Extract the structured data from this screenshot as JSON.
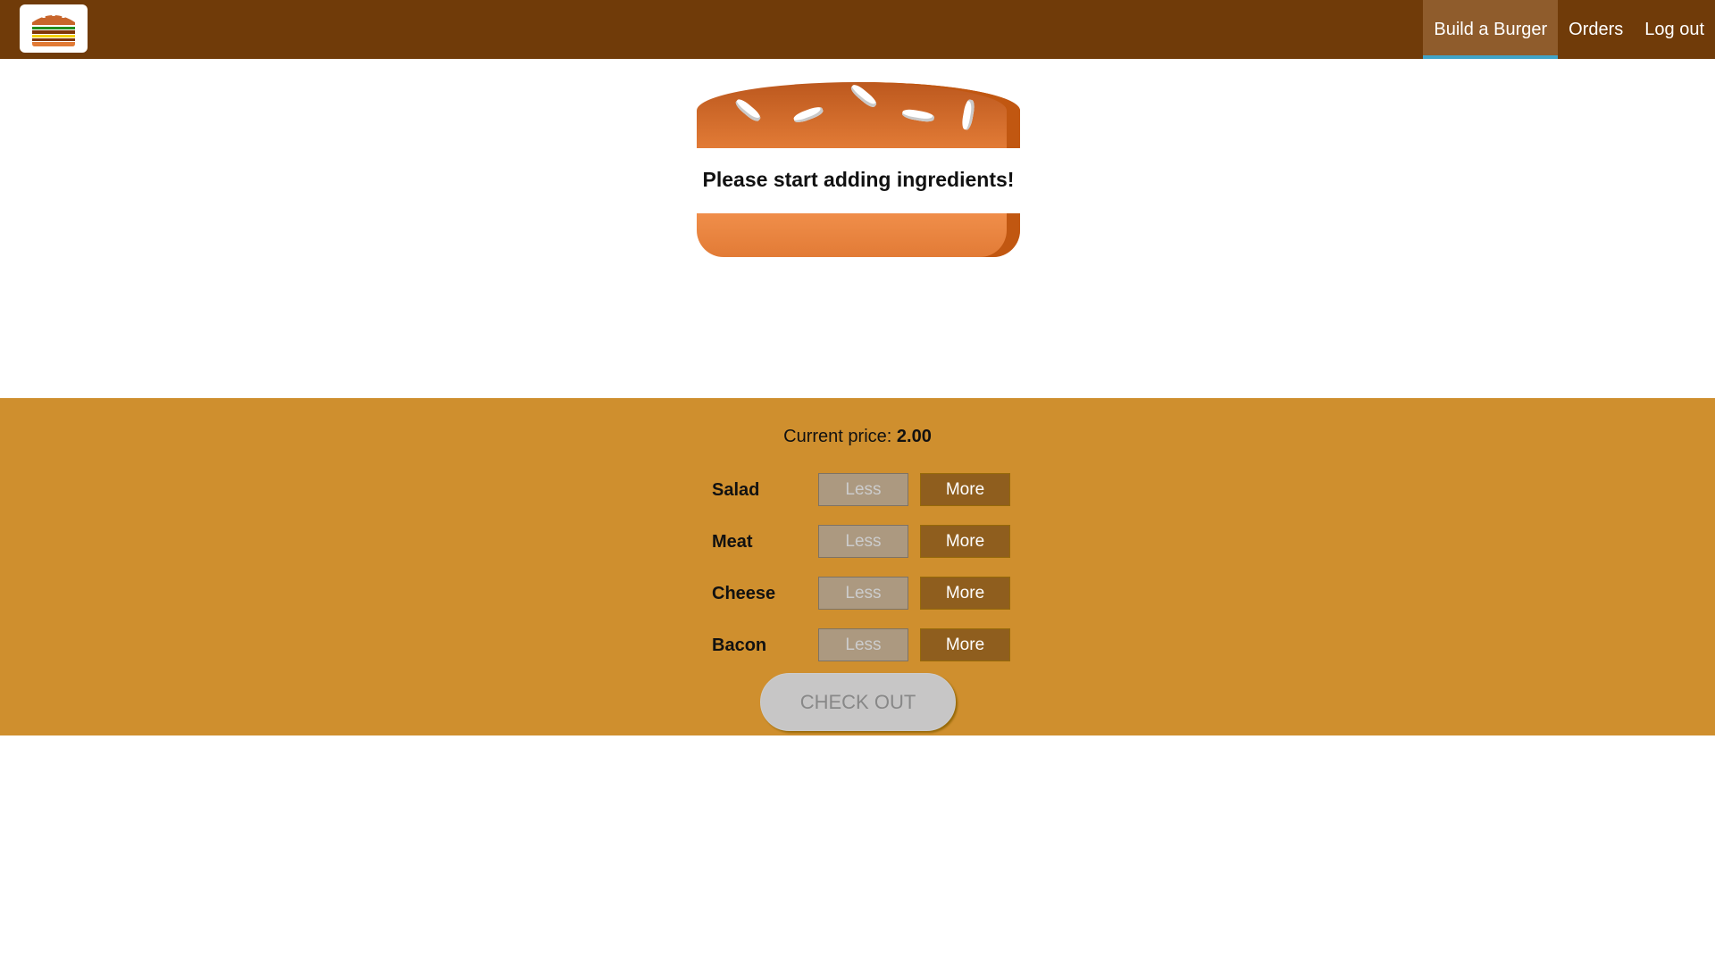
{
  "toolbar": {
    "logo_icon": "burger-logo-icon",
    "nav": [
      {
        "label": "Build a Burger",
        "active": true
      },
      {
        "label": "Orders",
        "active": false
      },
      {
        "label": "Log out",
        "active": false
      }
    ]
  },
  "burger": {
    "message": "Please start adding ingredients!"
  },
  "controls": {
    "price_label": "Current price:",
    "price_value": "2.00",
    "less_label": "Less",
    "more_label": "More",
    "ingredients": [
      {
        "label": "Salad"
      },
      {
        "label": "Meat"
      },
      {
        "label": "Cheese"
      },
      {
        "label": "Bacon"
      }
    ],
    "checkout_label": "CHECK OUT"
  },
  "colors": {
    "toolbar": "#703b09",
    "active_nav": "#8f5c2c",
    "active_underline": "#40a4c8",
    "controls_bg": "#cf8f2e",
    "more_button": "#8f5e1e",
    "less_button_disabled": "#ac9980",
    "checkout_disabled": "#c7c6c6"
  }
}
